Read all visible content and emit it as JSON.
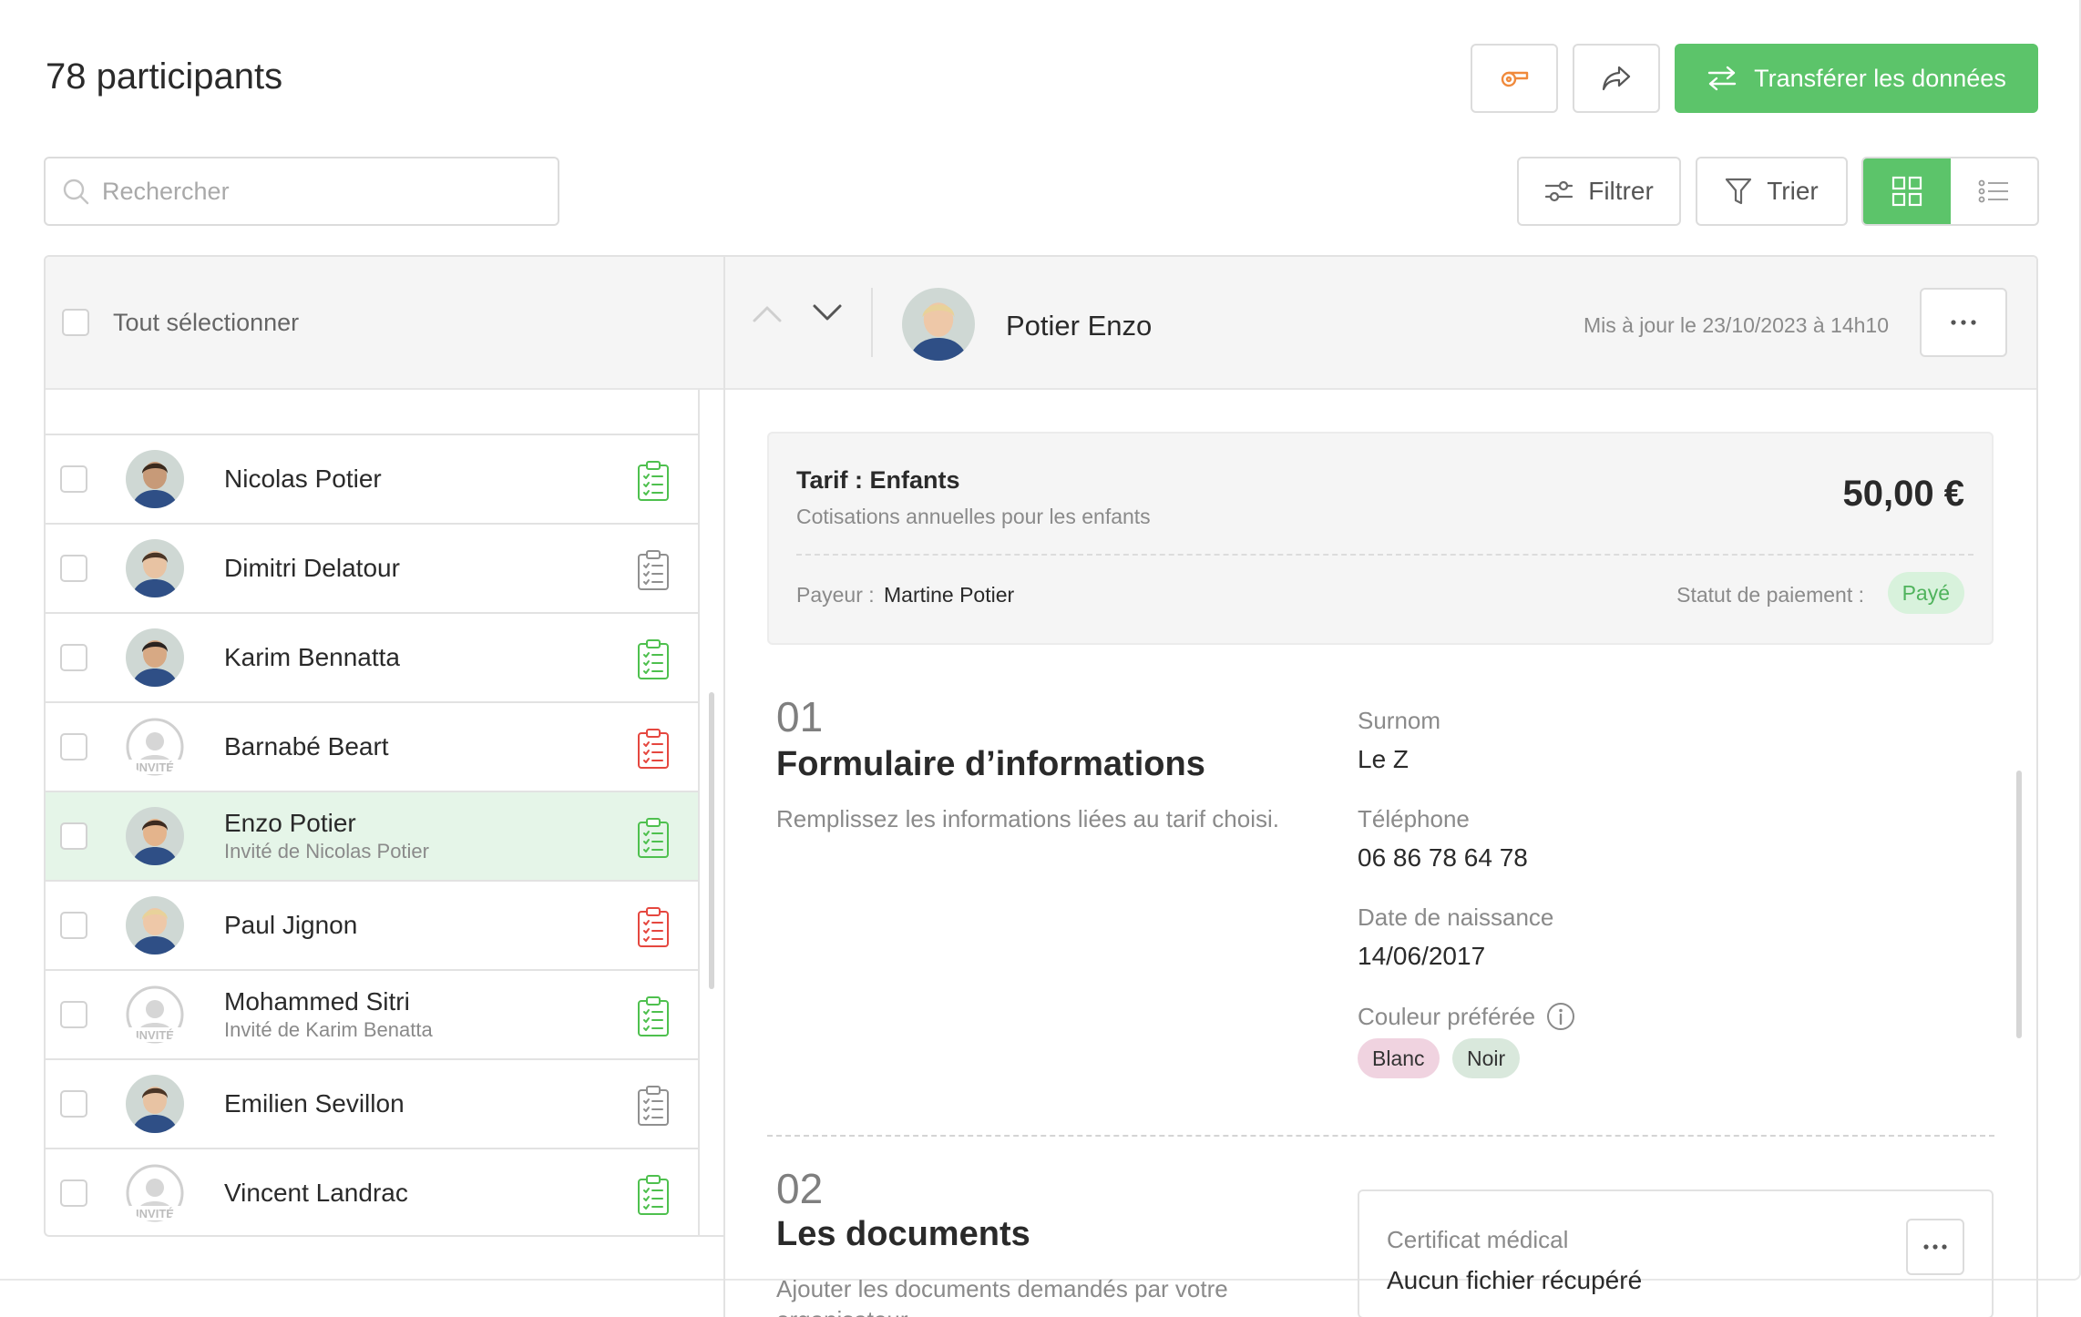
{
  "header": {
    "title": "78 participants",
    "transfer_label": "Transférer les données"
  },
  "search": {
    "placeholder": "Rechercher",
    "value": ""
  },
  "toolbar": {
    "filter_label": "Filtrer",
    "sort_label": "Trier",
    "active_view": "grid"
  },
  "list": {
    "select_all_label": "Tout sélectionner",
    "guest_label": "INVITÉ",
    "rows": [
      {
        "name": "Nicolas Potier",
        "sub": "",
        "avatar": "photo",
        "doc_status": "complete"
      },
      {
        "name": "Dimitri Delatour",
        "sub": "",
        "avatar": "photo",
        "doc_status": "none"
      },
      {
        "name": "Karim Bennatta",
        "sub": "",
        "avatar": "photo",
        "doc_status": "complete"
      },
      {
        "name": "Barnabé Beart",
        "sub": "",
        "avatar": "guest",
        "doc_status": "incomplete"
      },
      {
        "name": "Enzo Potier",
        "sub": "Invité de Nicolas Potier",
        "avatar": "photo",
        "doc_status": "complete",
        "selected": true
      },
      {
        "name": "Paul Jignon",
        "sub": "",
        "avatar": "photo",
        "doc_status": "incomplete"
      },
      {
        "name": "Mohammed Sitri",
        "sub": "Invité de Karim Benatta",
        "avatar": "guest",
        "doc_status": "complete"
      },
      {
        "name": "Emilien Sevillon",
        "sub": "",
        "avatar": "photo",
        "doc_status": "none"
      },
      {
        "name": "Vincent Landrac",
        "sub": "",
        "avatar": "guest",
        "doc_status": "complete"
      }
    ]
  },
  "detail": {
    "name": "Potier Enzo",
    "updated": "Mis à jour le 23/10/2023 à 14h10",
    "tarif": {
      "title": "Tarif : Enfants",
      "description": "Cotisations annuelles pour les enfants",
      "price": "50,00 €",
      "payer_label": "Payeur :",
      "payer_name": "Martine Potier",
      "status_label": "Statut de paiement :",
      "status_value": "Payé"
    },
    "section1": {
      "number": "01",
      "title": "Formulaire d’informations",
      "description": "Remplissez les informations liées au tarif choisi.",
      "fields": {
        "nickname_label": "Surnom",
        "nickname_value": "Le Z",
        "phone_label": "Téléphone",
        "phone_value": "06 86 78 64 78",
        "birth_label": "Date de naissance",
        "birth_value": "14/06/2017",
        "color_label": "Couleur préférée",
        "colors": [
          "Blanc",
          "Noir"
        ]
      }
    },
    "section2": {
      "number": "02",
      "title": "Les documents",
      "description": "Ajouter les documents demandés par votre organisateur",
      "doc_label": "Certificat médical",
      "doc_value": "Aucun fichier récupéré"
    }
  },
  "colors": {
    "accent": "#5cc46a",
    "doc_complete": "#4ec04e",
    "doc_incomplete": "#e5473f",
    "doc_none": "#8f8f8f",
    "chip_blanc": "#f0d3e0",
    "chip_noir": "#d9e8dc",
    "selected_row": "#e5f5e8"
  }
}
